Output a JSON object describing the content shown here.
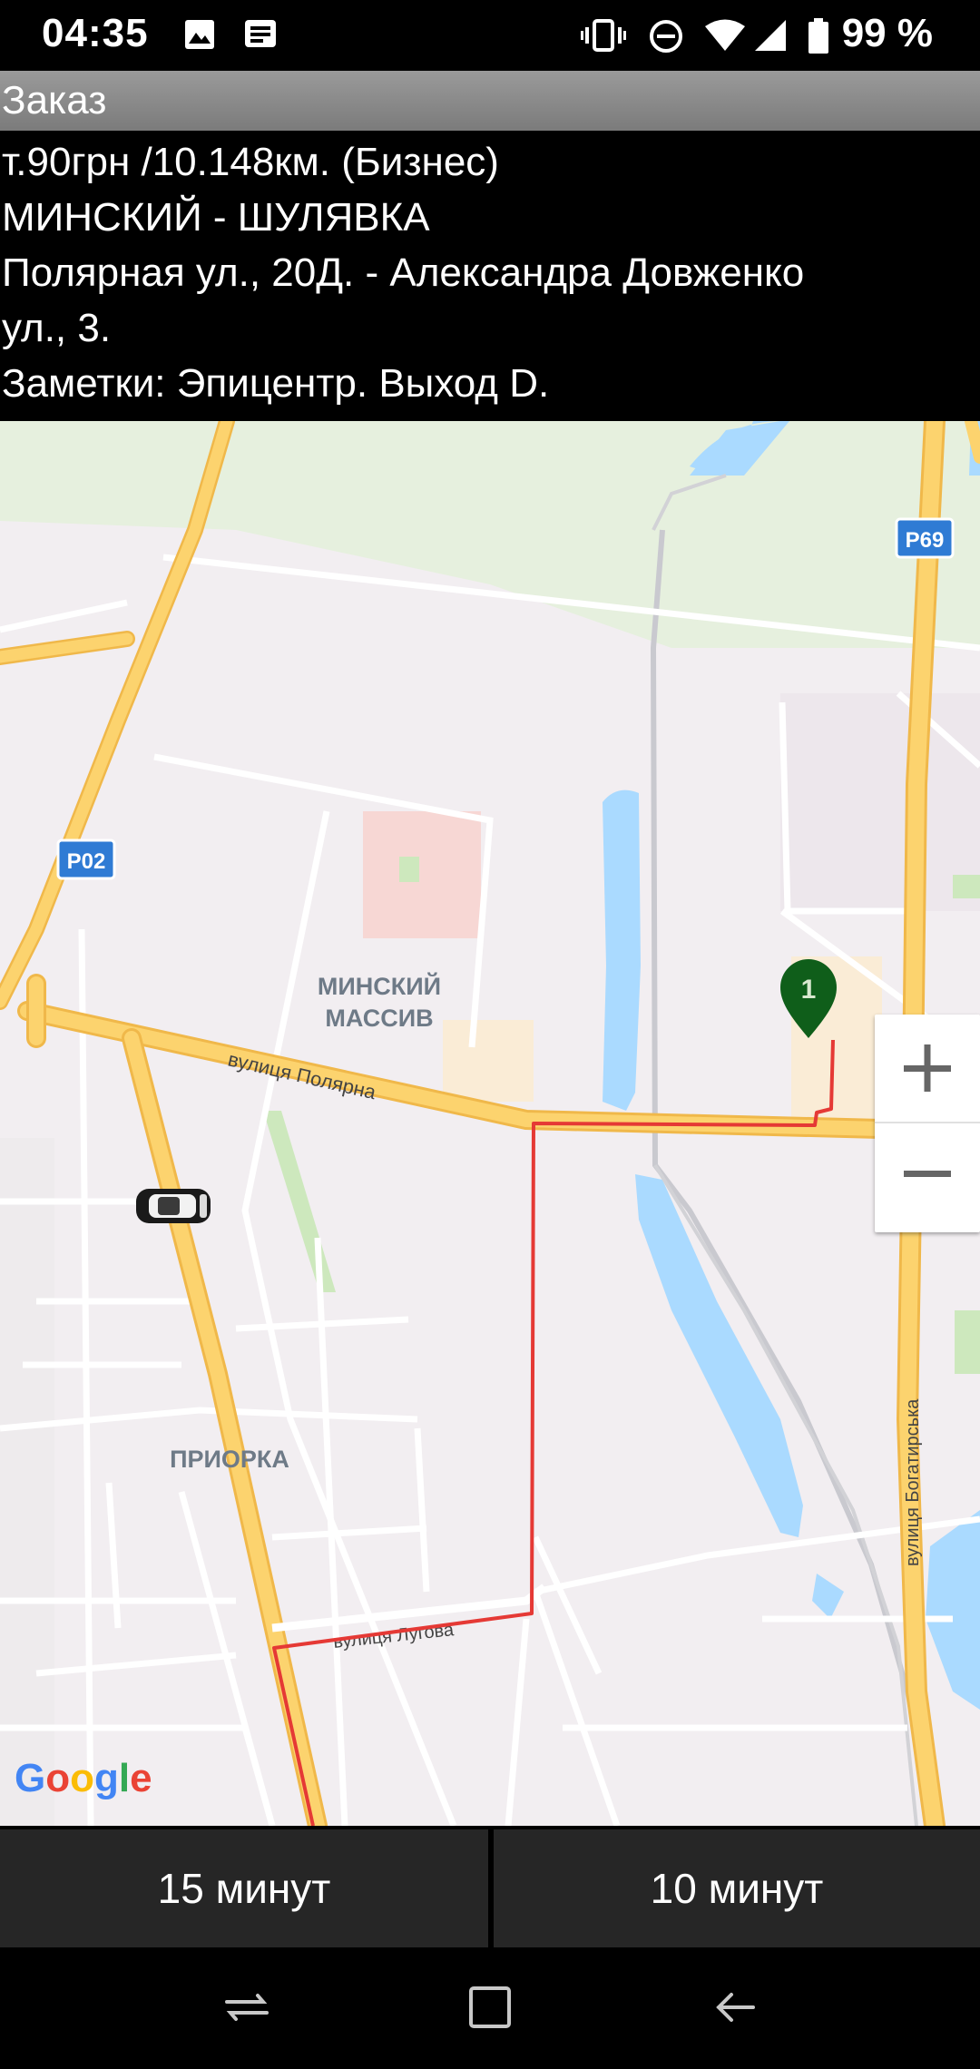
{
  "status_bar": {
    "time": "04:35",
    "battery": "99 %",
    "icons": [
      "image-icon",
      "message-icon",
      "vibrate-icon",
      "dnd-icon",
      "wifi-icon",
      "signal-icon",
      "battery-icon"
    ]
  },
  "header": {
    "title": "Заказ"
  },
  "order": {
    "price_line": "т.90грн /10.148км.  (Бизнес)",
    "route_districts": "МИНСКИЙ - ШУЛЯВКА",
    "address_line1": "Полярная ул., 20Д. - Александра Довженко",
    "address_line2": "ул., 3.",
    "notes": "Заметки: Эпицентр. Выход D."
  },
  "map": {
    "labels": {
      "highway_p69": "P69",
      "highway_p02": "P02",
      "district_minsky_1": "МИНСКИЙ",
      "district_minsky_2": "МАССИВ",
      "district_priorka": "ПРИОРКА",
      "street_polyarna": "вулиця Полярна",
      "street_luhova": "вулиця Лугова",
      "street_bohatyrska": "вулиця Богатирська",
      "marker_number": "1",
      "google_logo": "Google"
    },
    "colors": {
      "route": "#e53935",
      "marker": "#0f5e1a",
      "road_major": "#fcd370",
      "water": "#aadaff"
    }
  },
  "zoom": {
    "in": "+",
    "out": "−"
  },
  "buttons": {
    "first": "15 минут",
    "second": "10 минут"
  },
  "nav_bar": {
    "icons": [
      "recent-apps-icon",
      "home-icon",
      "back-icon"
    ]
  }
}
